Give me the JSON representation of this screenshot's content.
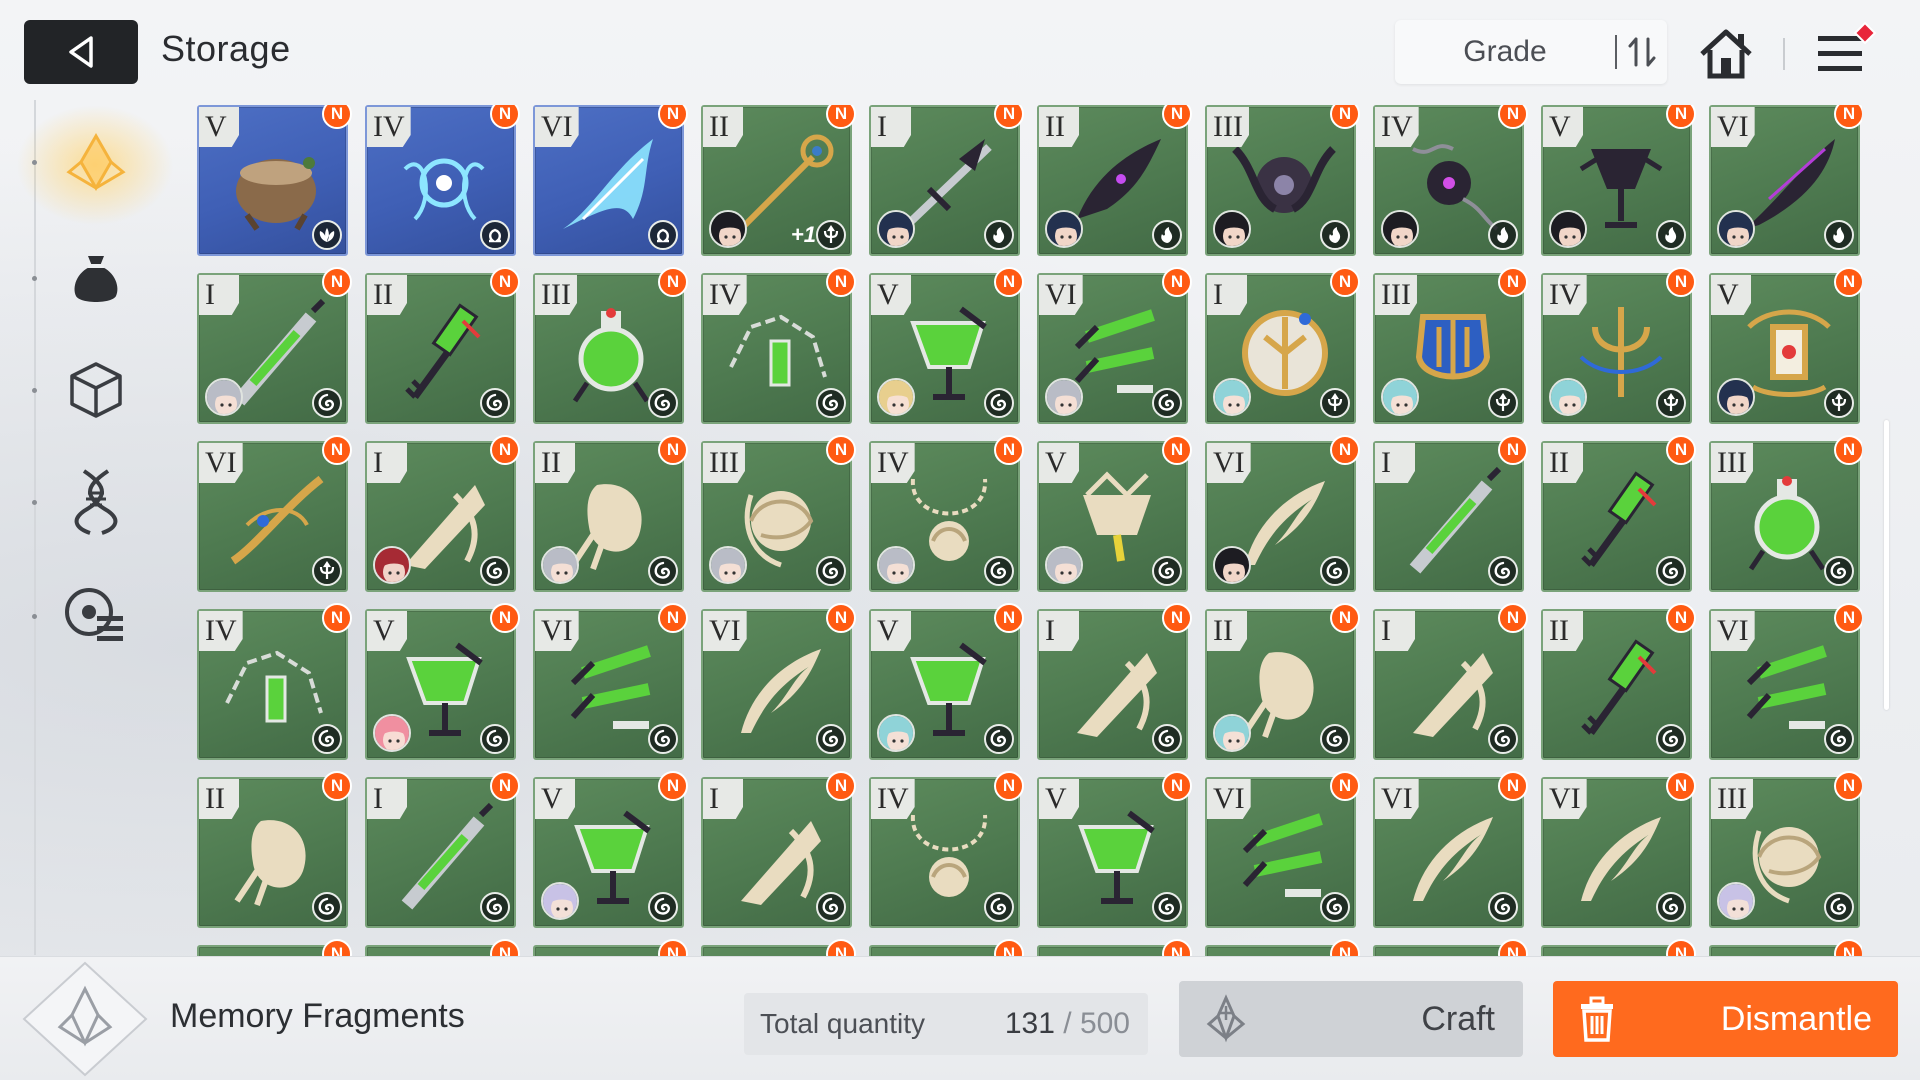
{
  "header": {
    "title": "Storage",
    "sort_label": "Grade"
  },
  "colors": {
    "accent": "#ff6a1e",
    "new_badge": "#ff5a12",
    "tile_green": "#4e7a50",
    "tile_blue": "#3f5fb5"
  },
  "sidebar": {
    "items": [
      {
        "icon": "memory-fragment-icon",
        "active": true
      },
      {
        "icon": "pouch-icon",
        "active": false
      },
      {
        "icon": "cube-icon",
        "active": false
      },
      {
        "icon": "dna-helix-icon",
        "active": false
      },
      {
        "icon": "disc-list-icon",
        "active": false
      }
    ]
  },
  "grid": {
    "new_label": "N",
    "items": [
      {
        "grade": "V",
        "bg": "blue",
        "art": "pot-relic",
        "type": "lotus-icon",
        "avatar": null
      },
      {
        "grade": "IV",
        "bg": "blue",
        "art": "ice-orb",
        "type": "omega-icon",
        "avatar": null
      },
      {
        "grade": "VI",
        "bg": "blue",
        "art": "ice-wing",
        "type": "omega-icon",
        "avatar": null
      },
      {
        "grade": "II",
        "bg": "green",
        "art": "golden-key",
        "type": "trident-icon",
        "avatar": "dark",
        "extra": "+1"
      },
      {
        "grade": "I",
        "bg": "green",
        "art": "dark-blade",
        "type": "flame-icon",
        "avatar": "navy"
      },
      {
        "grade": "II",
        "bg": "green",
        "art": "dark-wing",
        "type": "flame-icon",
        "avatar": "navy"
      },
      {
        "grade": "III",
        "bg": "green",
        "art": "dark-orb",
        "type": "flame-icon",
        "avatar": "dark"
      },
      {
        "grade": "IV",
        "bg": "green",
        "art": "dark-chain",
        "type": "flame-icon",
        "avatar": "dark"
      },
      {
        "grade": "V",
        "bg": "green",
        "art": "dark-goblet",
        "type": "flame-icon",
        "avatar": "dark"
      },
      {
        "grade": "VI",
        "bg": "green",
        "art": "dark-feather",
        "type": "flame-icon",
        "avatar": "navy"
      },
      {
        "grade": "I",
        "bg": "green",
        "art": "syringe",
        "type": "swirl-icon",
        "avatar": "silver"
      },
      {
        "grade": "II",
        "bg": "green",
        "art": "vial-key",
        "type": "swirl-icon",
        "avatar": null
      },
      {
        "grade": "III",
        "bg": "green",
        "art": "flask",
        "type": "swirl-icon",
        "avatar": null
      },
      {
        "grade": "IV",
        "bg": "green",
        "art": "chain-vial",
        "type": "swirl-icon",
        "avatar": null
      },
      {
        "grade": "V",
        "bg": "green",
        "art": "goblet",
        "type": "swirl-icon",
        "avatar": "blonde"
      },
      {
        "grade": "VI",
        "bg": "green",
        "art": "tubes",
        "type": "swirl-icon",
        "avatar": "silver"
      },
      {
        "grade": "I",
        "bg": "green",
        "art": "golden-emblem",
        "type": "trident-icon",
        "avatar": "teal"
      },
      {
        "grade": "III",
        "bg": "green",
        "art": "golden-crest",
        "type": "trident-icon",
        "avatar": "teal"
      },
      {
        "grade": "IV",
        "bg": "green",
        "art": "golden-trident",
        "type": "trident-icon",
        "avatar": "teal"
      },
      {
        "grade": "V",
        "bg": "green",
        "art": "golden-lantern",
        "type": "trident-icon",
        "avatar": "navy"
      },
      {
        "grade": "VI",
        "bg": "green",
        "art": "golden-arc",
        "type": "trident-icon",
        "avatar": null
      },
      {
        "grade": "I",
        "bg": "green",
        "art": "bone-spire",
        "type": "swirl-icon",
        "avatar": "red"
      },
      {
        "grade": "II",
        "bg": "green",
        "art": "bone-mask",
        "type": "swirl-icon",
        "avatar": "silver"
      },
      {
        "grade": "III",
        "bg": "green",
        "art": "bone-shell",
        "type": "swirl-icon",
        "avatar": "silver"
      },
      {
        "grade": "IV",
        "bg": "green",
        "art": "bone-necklace",
        "type": "swirl-icon",
        "avatar": "silver"
      },
      {
        "grade": "V",
        "bg": "green",
        "art": "bone-chalice",
        "type": "swirl-icon",
        "avatar": "silver"
      },
      {
        "grade": "VI",
        "bg": "green",
        "art": "bone-wing",
        "type": "swirl-icon",
        "avatar": "dark"
      },
      {
        "grade": "I",
        "bg": "green",
        "art": "syringe",
        "type": "swirl-icon",
        "avatar": null
      },
      {
        "grade": "II",
        "bg": "green",
        "art": "vial-key",
        "type": "swirl-icon",
        "avatar": null
      },
      {
        "grade": "III",
        "bg": "green",
        "art": "flask",
        "type": "swirl-icon",
        "avatar": null
      },
      {
        "grade": "IV",
        "bg": "green",
        "art": "chain-vial",
        "type": "swirl-icon",
        "avatar": null
      },
      {
        "grade": "V",
        "bg": "green",
        "art": "goblet",
        "type": "swirl-icon",
        "avatar": "pink"
      },
      {
        "grade": "VI",
        "bg": "green",
        "art": "tubes",
        "type": "swirl-icon",
        "avatar": null
      },
      {
        "grade": "VI",
        "bg": "green",
        "art": "bone-wing",
        "type": "swirl-icon",
        "avatar": null
      },
      {
        "grade": "V",
        "bg": "green",
        "art": "goblet",
        "type": "swirl-icon",
        "avatar": "teal"
      },
      {
        "grade": "I",
        "bg": "green",
        "art": "bone-spire",
        "type": "swirl-icon",
        "avatar": null
      },
      {
        "grade": "II",
        "bg": "green",
        "art": "bone-mask",
        "type": "swirl-icon",
        "avatar": "teal"
      },
      {
        "grade": "I",
        "bg": "green",
        "art": "bone-spire",
        "type": "swirl-icon",
        "avatar": null
      },
      {
        "grade": "II",
        "bg": "green",
        "art": "vial-key",
        "type": "swirl-icon",
        "avatar": null
      },
      {
        "grade": "VI",
        "bg": "green",
        "art": "tubes",
        "type": "swirl-icon",
        "avatar": null
      },
      {
        "grade": "II",
        "bg": "green",
        "art": "bone-mask",
        "type": "swirl-icon",
        "avatar": null
      },
      {
        "grade": "I",
        "bg": "green",
        "art": "syringe",
        "type": "swirl-icon",
        "avatar": null
      },
      {
        "grade": "V",
        "bg": "green",
        "art": "goblet",
        "type": "swirl-icon",
        "avatar": "lilac"
      },
      {
        "grade": "I",
        "bg": "green",
        "art": "bone-spire",
        "type": "swirl-icon",
        "avatar": null
      },
      {
        "grade": "IV",
        "bg": "green",
        "art": "bone-necklace",
        "type": "swirl-icon",
        "avatar": null
      },
      {
        "grade": "V",
        "bg": "green",
        "art": "goblet",
        "type": "swirl-icon",
        "avatar": null
      },
      {
        "grade": "VI",
        "bg": "green",
        "art": "tubes",
        "type": "swirl-icon",
        "avatar": null
      },
      {
        "grade": "VI",
        "bg": "green",
        "art": "bone-wing",
        "type": "swirl-icon",
        "avatar": null
      },
      {
        "grade": "VI",
        "bg": "green",
        "art": "bone-wing",
        "type": "swirl-icon",
        "avatar": null
      },
      {
        "grade": "III",
        "bg": "green",
        "art": "bone-shell",
        "type": "swirl-icon",
        "avatar": "lilac"
      },
      {
        "grade": "",
        "bg": "green",
        "art": "partial",
        "type": "",
        "avatar": null
      },
      {
        "grade": "",
        "bg": "green",
        "art": "partial",
        "type": "",
        "avatar": null
      },
      {
        "grade": "",
        "bg": "green",
        "art": "partial",
        "type": "",
        "avatar": null
      },
      {
        "grade": "",
        "bg": "green",
        "art": "partial",
        "type": "",
        "avatar": null
      },
      {
        "grade": "",
        "bg": "green",
        "art": "partial",
        "type": "",
        "avatar": null
      },
      {
        "grade": "",
        "bg": "green",
        "art": "partial",
        "type": "",
        "avatar": null
      },
      {
        "grade": "",
        "bg": "green",
        "art": "partial",
        "type": "",
        "avatar": null
      },
      {
        "grade": "",
        "bg": "green",
        "art": "partial",
        "type": "",
        "avatar": null
      },
      {
        "grade": "",
        "bg": "green",
        "art": "partial",
        "type": "",
        "avatar": null
      },
      {
        "grade": "",
        "bg": "green",
        "art": "partial",
        "type": "",
        "avatar": null
      }
    ]
  },
  "footer": {
    "category_label": "Memory Fragments",
    "total_label": "Total quantity",
    "quantity_current": "131",
    "quantity_max": " / 500",
    "craft_label": "Craft",
    "dismantle_label": "Dismantle"
  }
}
